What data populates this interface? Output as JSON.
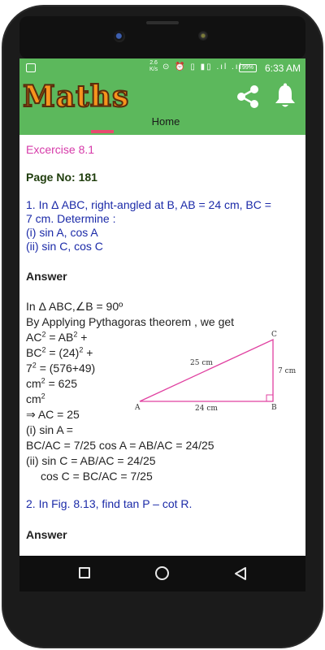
{
  "status_bar": {
    "speed_value": "2.6",
    "speed_unit": "K/s",
    "icons": "⊙ ⏰ ▯ ▮▯ .ıl .ıl",
    "battery": "99%",
    "time": "6:33 AM"
  },
  "app_bar": {
    "logo_text": "Maths",
    "tab_label": "Home",
    "colors": {
      "bar": "#5cb85c",
      "logo": "#f7941d",
      "indicator": "#e94a6f"
    }
  },
  "content": {
    "exercise_title": "Excercise 8.1",
    "page_no": "Page No: 181",
    "question1": {
      "line1": "1. In Δ ABC, right-angled at B, AB = 24 cm, BC =",
      "line2": "7 cm. Determine :",
      "line3": "(i) sin A, cos A",
      "line4": "(ii) sin C, cos C"
    },
    "answer_heading": "Answer",
    "answer_lines": {
      "l1": "In Δ ABC,∠B = 90º",
      "l2": "By Applying Pythagoras theorem , we get",
      "l3a": "AC",
      "l3b": "2",
      "l3c": " = AB",
      "l3d": "2",
      "l3e": " +",
      "l4a": "BC",
      "l4b": "2",
      "l4c": " = (24)",
      "l4d": "2",
      "l4e": " +",
      "l5a": "7",
      "l5b": "2",
      "l5c": " = (576+49)",
      "l6a": "cm",
      "l6b": "2",
      "l6c": " = 625",
      "l7a": "cm",
      "l7b": "2",
      "l8": "⇒ AC = 25",
      "l9": "(i) sin A =",
      "l10": "BC/AC = 7/25    cos A = AB/AC = 24/25",
      "l11": "(ii) sin C = AB/AC = 24/25",
      "l12": "cos C = BC/AC = 7/25"
    },
    "figure": {
      "label_a": "A",
      "label_b": "B",
      "label_c": "C",
      "label_ac": "25 cm",
      "label_ab": "24 cm",
      "label_bc": "7 cm"
    },
    "question2": "2.  In Fig. 8.13, find tan P – cot R.",
    "answer2_heading": "Answer"
  }
}
